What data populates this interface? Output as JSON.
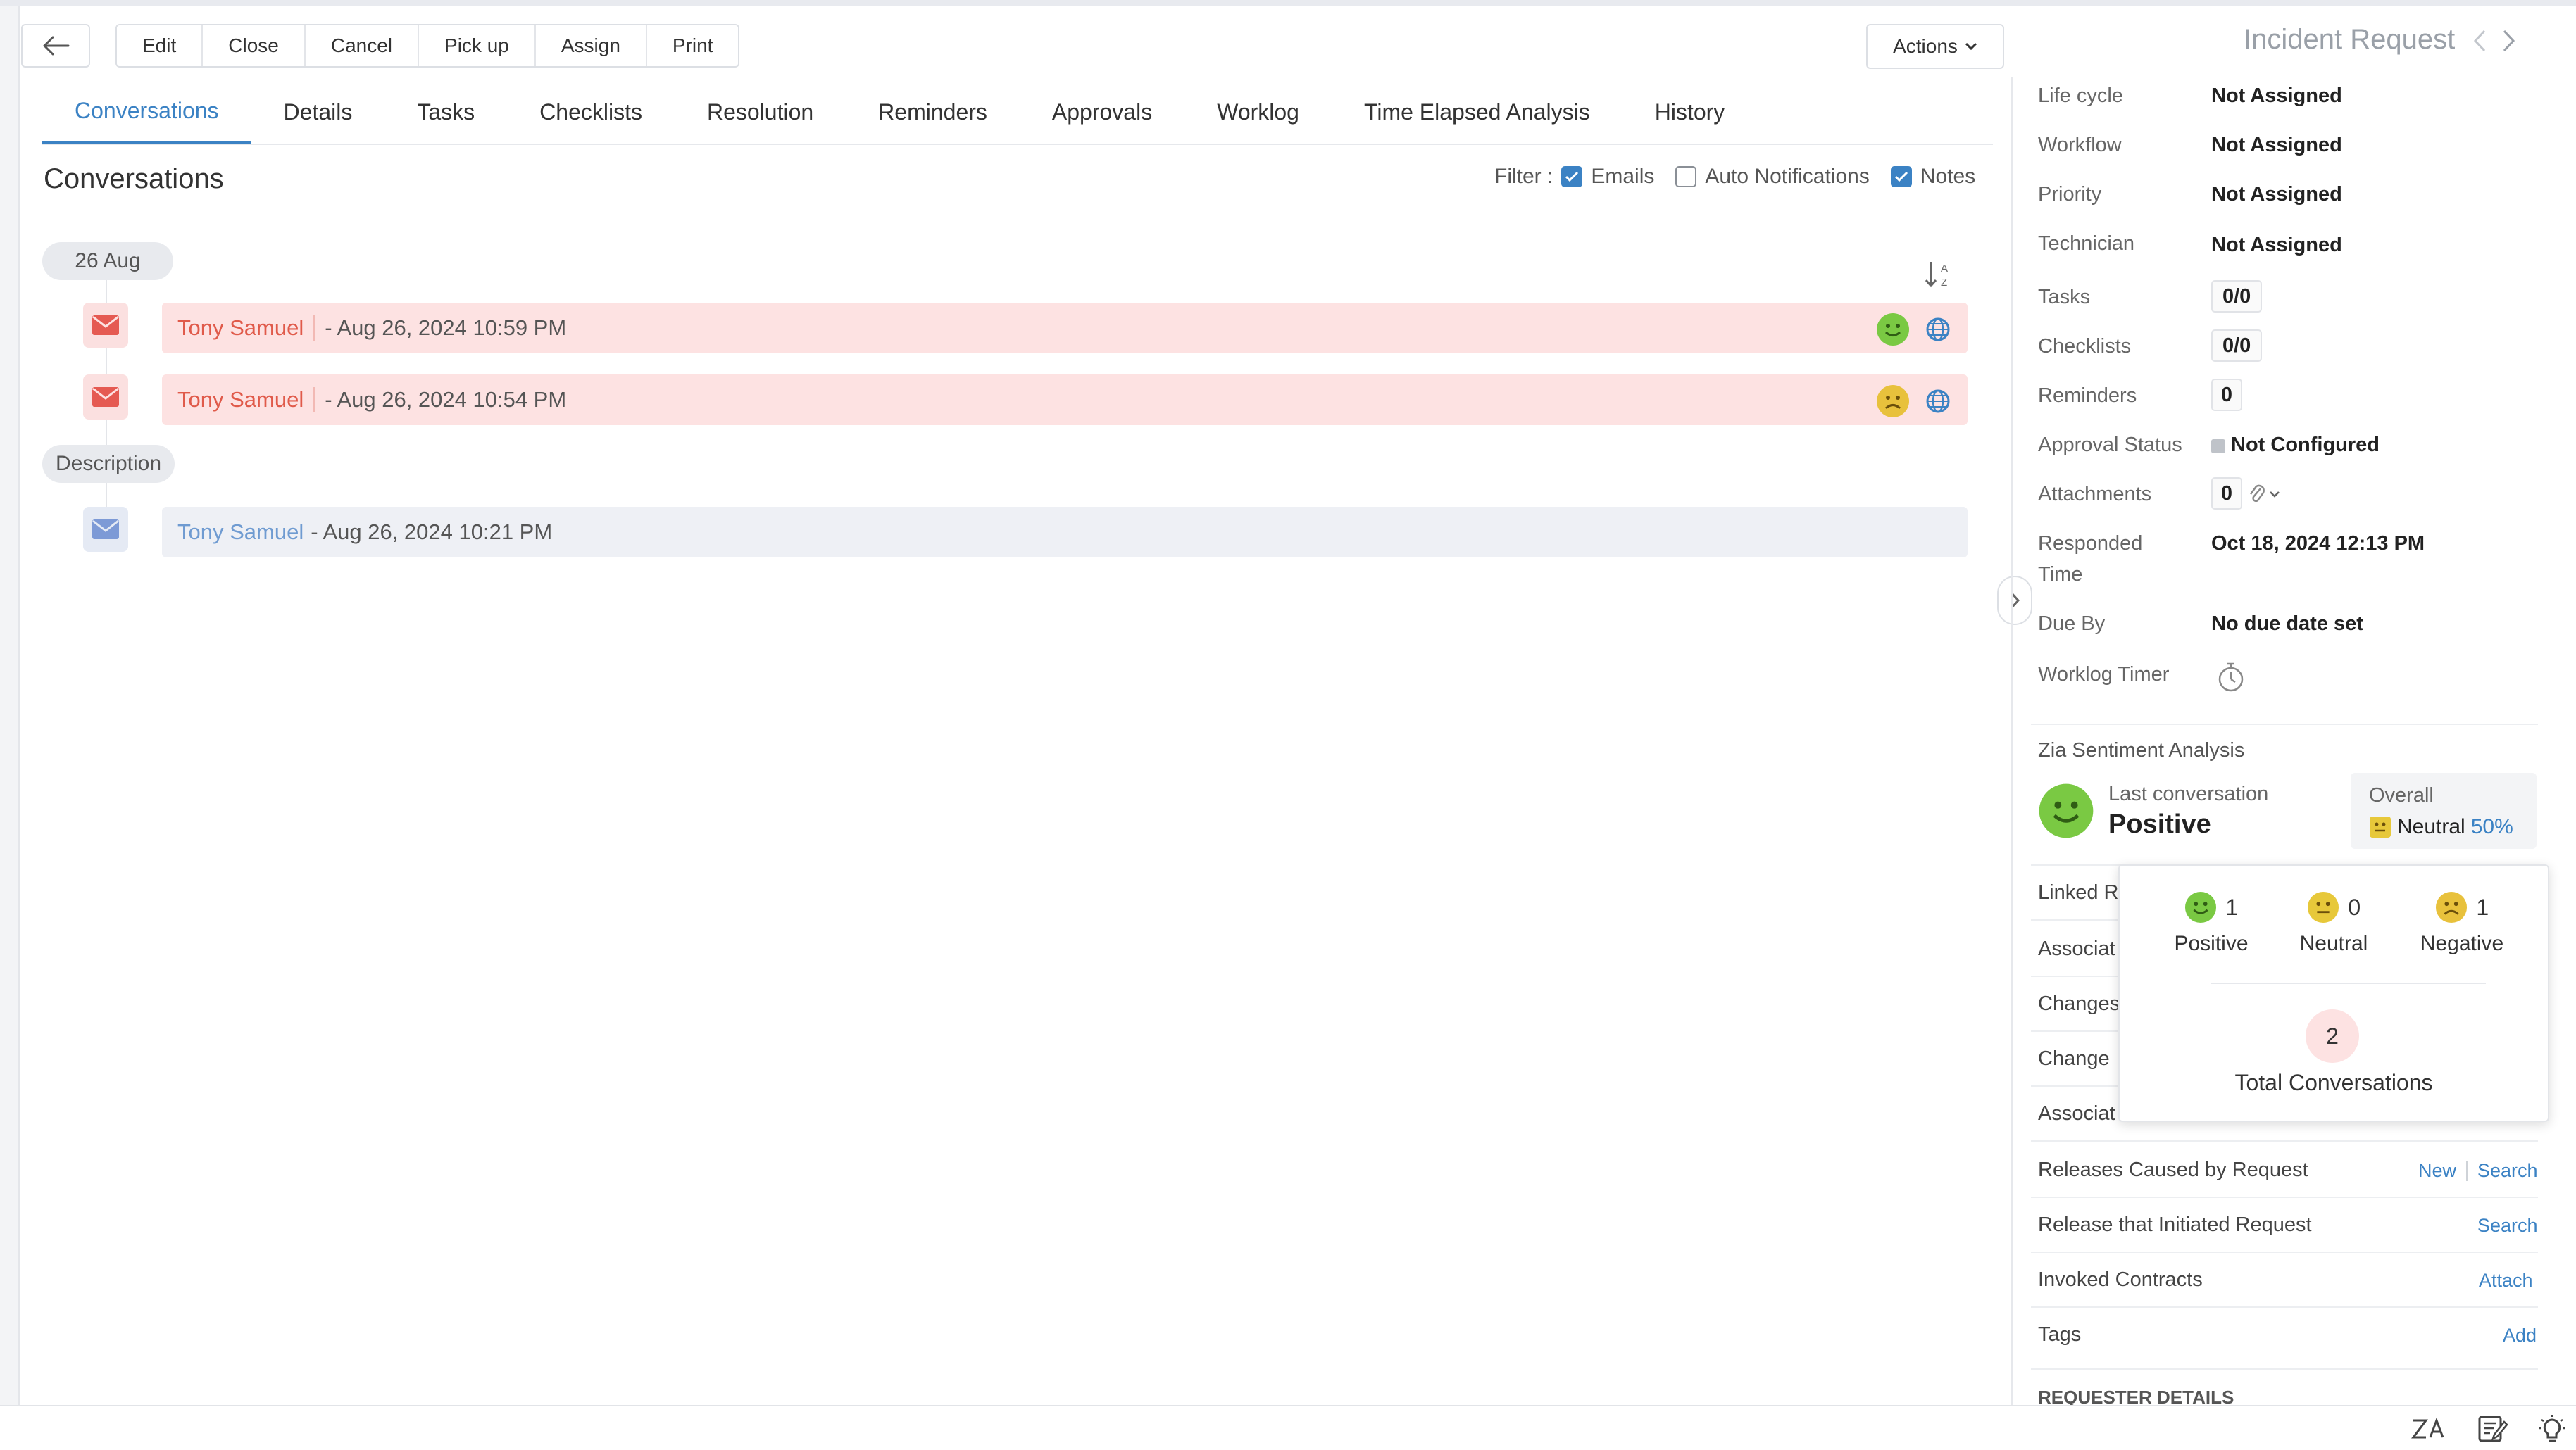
{
  "toolbar": {
    "buttons": [
      "Edit",
      "Close",
      "Cancel",
      "Pick up",
      "Assign",
      "Print"
    ],
    "actions_label": "Actions",
    "title": "Incident Request"
  },
  "tabs": [
    {
      "label": "Conversations",
      "active": true
    },
    {
      "label": "Details"
    },
    {
      "label": "Tasks"
    },
    {
      "label": "Checklists"
    },
    {
      "label": "Resolution"
    },
    {
      "label": "Reminders"
    },
    {
      "label": "Approvals"
    },
    {
      "label": "Worklog"
    },
    {
      "label": "Time Elapsed Analysis"
    },
    {
      "label": "History"
    }
  ],
  "main": {
    "title": "Conversations",
    "filter": {
      "label": "Filter :",
      "options": [
        {
          "label": "Emails",
          "checked": true
        },
        {
          "label": "Auto Notifications",
          "checked": false
        },
        {
          "label": "Notes",
          "checked": true
        }
      ]
    },
    "date_group": "26 Aug",
    "conversations": [
      {
        "author": "Tony Samuel",
        "time": "- Aug 26, 2024 10:59 PM",
        "sentiment": "positive"
      },
      {
        "author": "Tony Samuel",
        "time": "- Aug 26, 2024 10:54 PM",
        "sentiment": "negative"
      }
    ],
    "description_label": "Description",
    "description": {
      "author": "Tony Samuel",
      "time": "- Aug 26, 2024 10:21 PM"
    }
  },
  "properties": {
    "lifecycle": {
      "label": "Life cycle",
      "value": "Not Assigned"
    },
    "workflow": {
      "label": "Workflow",
      "value": "Not Assigned"
    },
    "priority": {
      "label": "Priority",
      "value": "Not Assigned"
    },
    "technician": {
      "label": "Technician",
      "value": "Not Assigned"
    },
    "tasks": {
      "label": "Tasks",
      "value": "0/0"
    },
    "checklists": {
      "label": "Checklists",
      "value": "0/0"
    },
    "reminders": {
      "label": "Reminders",
      "value": "0"
    },
    "approval_status": {
      "label": "Approval Status",
      "value": "Not Configured"
    },
    "attachments": {
      "label": "Attachments",
      "value": "0"
    },
    "responded_time": {
      "label_line1": "Responded",
      "label_line2": "Time",
      "value": "Oct 18, 2024 12:13 PM"
    },
    "due_by": {
      "label": "Due By",
      "value": "No due date set"
    },
    "worklog_timer": {
      "label": "Worklog Timer"
    }
  },
  "sentiment": {
    "title": "Zia Sentiment Analysis",
    "last_label": "Last conversation",
    "last_value": "Positive",
    "overall_label": "Overall",
    "overall_value": "Neutral",
    "overall_percent": "50%",
    "popup": {
      "positive": {
        "count": "1",
        "label": "Positive"
      },
      "neutral": {
        "count": "0",
        "label": "Neutral"
      },
      "negative": {
        "count": "1",
        "label": "Negative"
      },
      "total_count": "2",
      "total_label": "Total Conversations"
    }
  },
  "related": {
    "linked": "Linked R",
    "associat1": "Associat",
    "changes": "Changes",
    "change": "Change",
    "associat2": "Associat",
    "releases_caused": {
      "label": "Releases Caused by Request",
      "new": "New",
      "search": "Search"
    },
    "release_initiated": {
      "label": "Release that Initiated Request",
      "search": "Search"
    },
    "invoked_contracts": {
      "label": "Invoked Contracts",
      "attach": "Attach"
    },
    "tags": {
      "label": "Tags",
      "add": "Add"
    },
    "requester_details": "REQUESTER DETAILS"
  },
  "colors": {
    "accent": "#3b82c4",
    "email_red": "#e05a4a",
    "positive": "#7ac943",
    "neutral": "#e7c83a",
    "negative": "#e8c13c"
  }
}
